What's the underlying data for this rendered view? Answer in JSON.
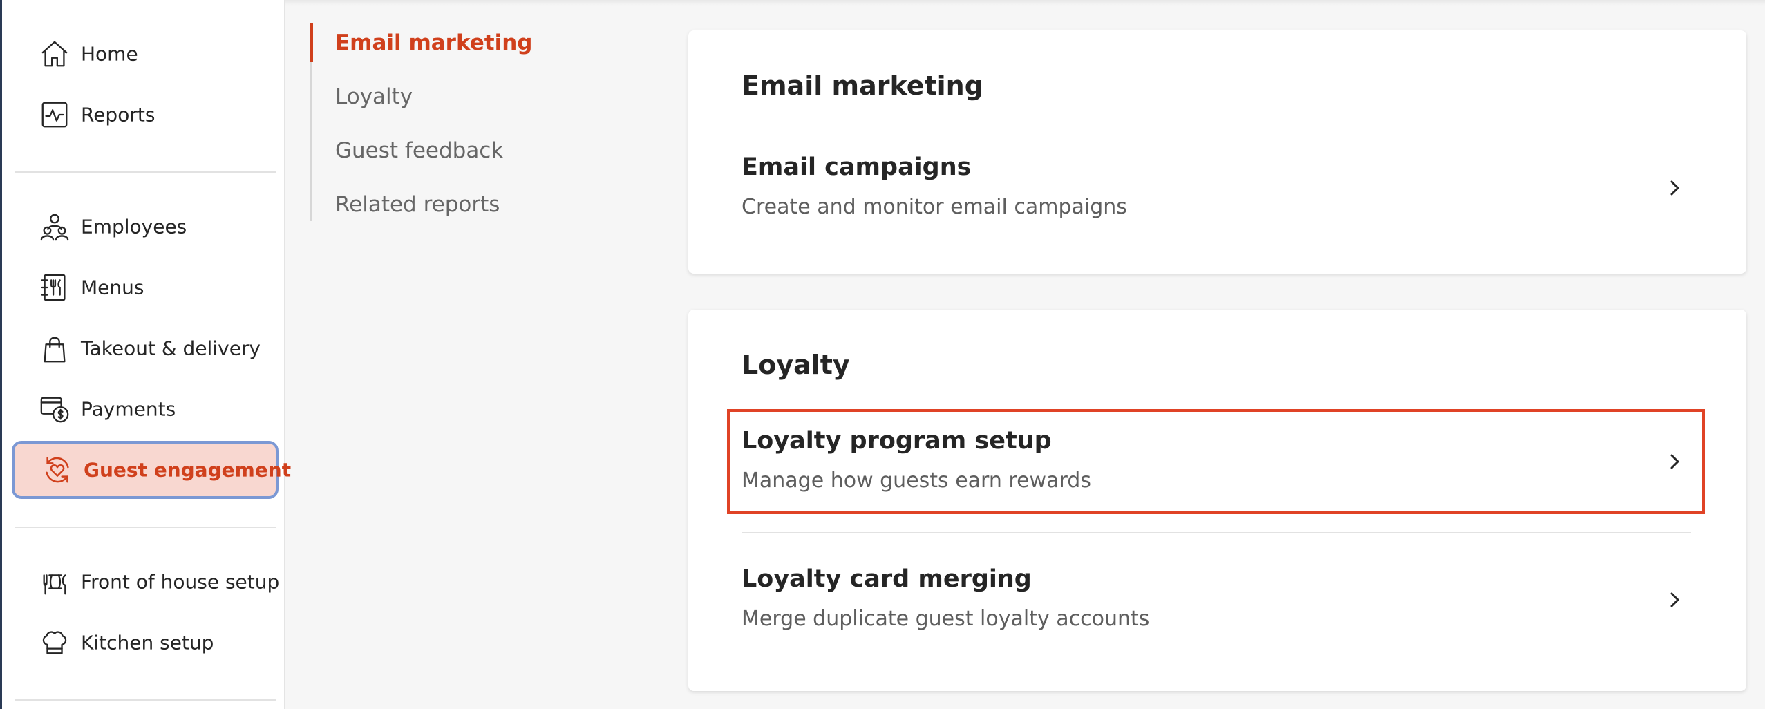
{
  "colors": {
    "accent": "#d0401c",
    "active_bg": "#f8d7d0",
    "focus_ring": "#7b98d4",
    "highlight_border": "#e04326"
  },
  "sidebar": {
    "items": [
      {
        "label": "Home",
        "icon": "home-icon"
      },
      {
        "label": "Reports",
        "icon": "reports-icon"
      },
      {
        "label": "Employees",
        "icon": "employees-icon"
      },
      {
        "label": "Menus",
        "icon": "menus-icon"
      },
      {
        "label": "Takeout & delivery",
        "icon": "shopping-bag-icon"
      },
      {
        "label": "Payments",
        "icon": "payments-icon"
      },
      {
        "label": "Guest engagement",
        "icon": "guest-engagement-icon",
        "active": true
      },
      {
        "label": "Front of house setup",
        "icon": "front-of-house-icon"
      },
      {
        "label": "Kitchen setup",
        "icon": "chef-hat-icon"
      }
    ]
  },
  "subnav": {
    "items": [
      {
        "label": "Email marketing",
        "active": true
      },
      {
        "label": "Loyalty"
      },
      {
        "label": "Guest feedback"
      },
      {
        "label": "Related reports"
      }
    ]
  },
  "sections": {
    "email": {
      "title": "Email marketing",
      "rows": [
        {
          "title": "Email campaigns",
          "description": "Create and monitor email campaigns"
        }
      ]
    },
    "loyalty": {
      "title": "Loyalty",
      "rows": [
        {
          "title": "Loyalty program setup",
          "description": "Manage how guests earn rewards",
          "highlighted": true
        },
        {
          "title": "Loyalty card merging",
          "description": "Merge duplicate guest loyalty accounts"
        }
      ]
    }
  }
}
